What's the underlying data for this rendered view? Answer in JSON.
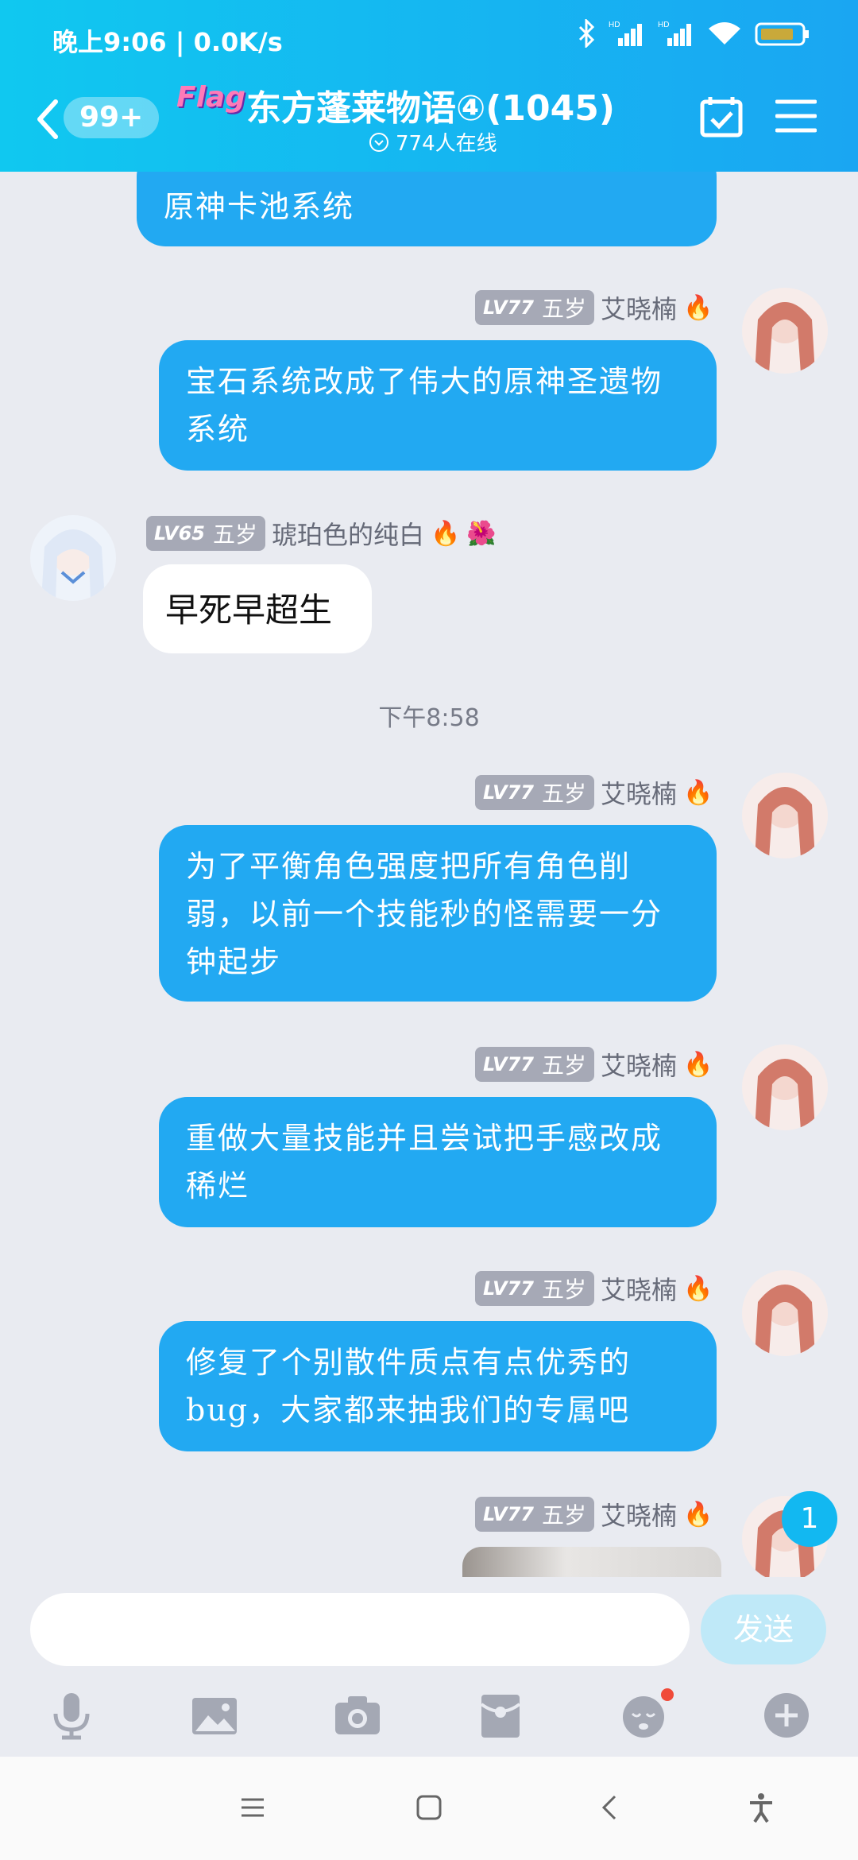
{
  "status": {
    "time": "晚上9:06 | 0.0K/s",
    "battery_color": "#c9a93a"
  },
  "header": {
    "back_badge": "99+",
    "flag_text": "Flag",
    "title": "东方蓬莱物语④(1045)",
    "online": "774人在线"
  },
  "messages": [
    {
      "sender": "me",
      "text": "原神卡池系统"
    },
    {
      "sender": "me",
      "lv": "LV77",
      "age": "五岁",
      "name": "艾晓楠",
      "text": "宝石系统改成了伟大的原神圣遗物系统"
    },
    {
      "sender": "other",
      "lv": "LV65",
      "age": "五岁",
      "name": "琥珀色的纯白",
      "text": "早死早超生"
    },
    {
      "timestamp": "下午8:58"
    },
    {
      "sender": "me",
      "lv": "LV77",
      "age": "五岁",
      "name": "艾晓楠",
      "text": "为了平衡角色强度把所有角色削弱，以前一个技能秒的怪需要一分钟起步"
    },
    {
      "sender": "me",
      "lv": "LV77",
      "age": "五岁",
      "name": "艾晓楠",
      "text": "重做大量技能并且尝试把手感改成稀烂"
    },
    {
      "sender": "me",
      "lv": "LV77",
      "age": "五岁",
      "name": "艾晓楠",
      "text": "修复了个别散件质点有点优秀的bug，大家都来抽我们的专属吧"
    },
    {
      "sender": "me",
      "lv": "LV77",
      "age": "五岁",
      "name": "艾晓楠",
      "text": ""
    }
  ],
  "unread_count": "1",
  "input": {
    "placeholder": "",
    "send_label": "发送"
  },
  "tools": [
    "mic-icon",
    "image-icon",
    "camera-icon",
    "red-packet-icon",
    "emoji-icon",
    "plus-icon"
  ]
}
